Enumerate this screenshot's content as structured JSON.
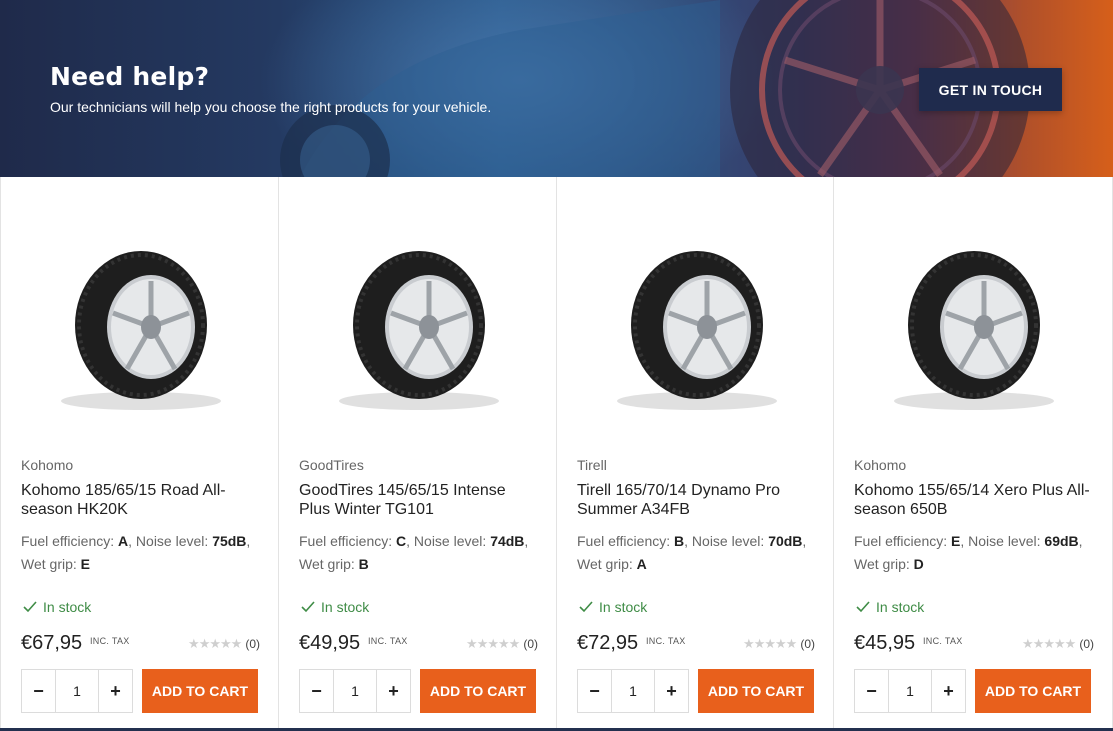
{
  "banner": {
    "title": "Need help?",
    "subtitle": "Our technicians will help you choose the right products for your vehicle.",
    "cta_label": "GET IN TOUCH"
  },
  "labels": {
    "fuel": "Fuel efficiency: ",
    "noise": ", Noise level: ",
    "wet": "Wet grip: ",
    "tax": "INC. TAX",
    "add_to_cart": "ADD TO CART",
    "minus": "−",
    "plus": "+"
  },
  "products": [
    {
      "brand": "Kohomo",
      "title": "Kohomo 185/65/15 Road All-season HK20K",
      "fuel": "A",
      "noise": "75dB",
      "wet": "E",
      "stock": "In stock",
      "price": "€67,95",
      "rating_count": "(0)",
      "rating": 0,
      "qty": "1"
    },
    {
      "brand": "GoodTires",
      "title": "GoodTires 145/65/15 Intense Plus Winter TG101",
      "fuel": "C",
      "noise": "74dB",
      "wet": "B",
      "stock": "In stock",
      "price": "€49,95",
      "rating_count": "(0)",
      "rating": 0,
      "qty": "1"
    },
    {
      "brand": "Tirell",
      "title": "Tirell 165/70/14 Dynamo Pro Summer A34FB",
      "fuel": "B",
      "noise": "70dB",
      "wet": "A",
      "stock": "In stock",
      "price": "€72,95",
      "rating_count": "(0)",
      "rating": 0,
      "qty": "1"
    },
    {
      "brand": "Kohomo",
      "title": "Kohomo 155/65/14 Xero Plus All-season 650B",
      "fuel": "E",
      "noise": "69dB",
      "wet": "D",
      "stock": "In stock",
      "price": "€45,95",
      "rating_count": "(0)",
      "rating": 0,
      "qty": "1"
    }
  ],
  "colors": {
    "accent": "#e8601c",
    "navy": "#1f2b4d",
    "stock_green": "#3f8c46"
  }
}
